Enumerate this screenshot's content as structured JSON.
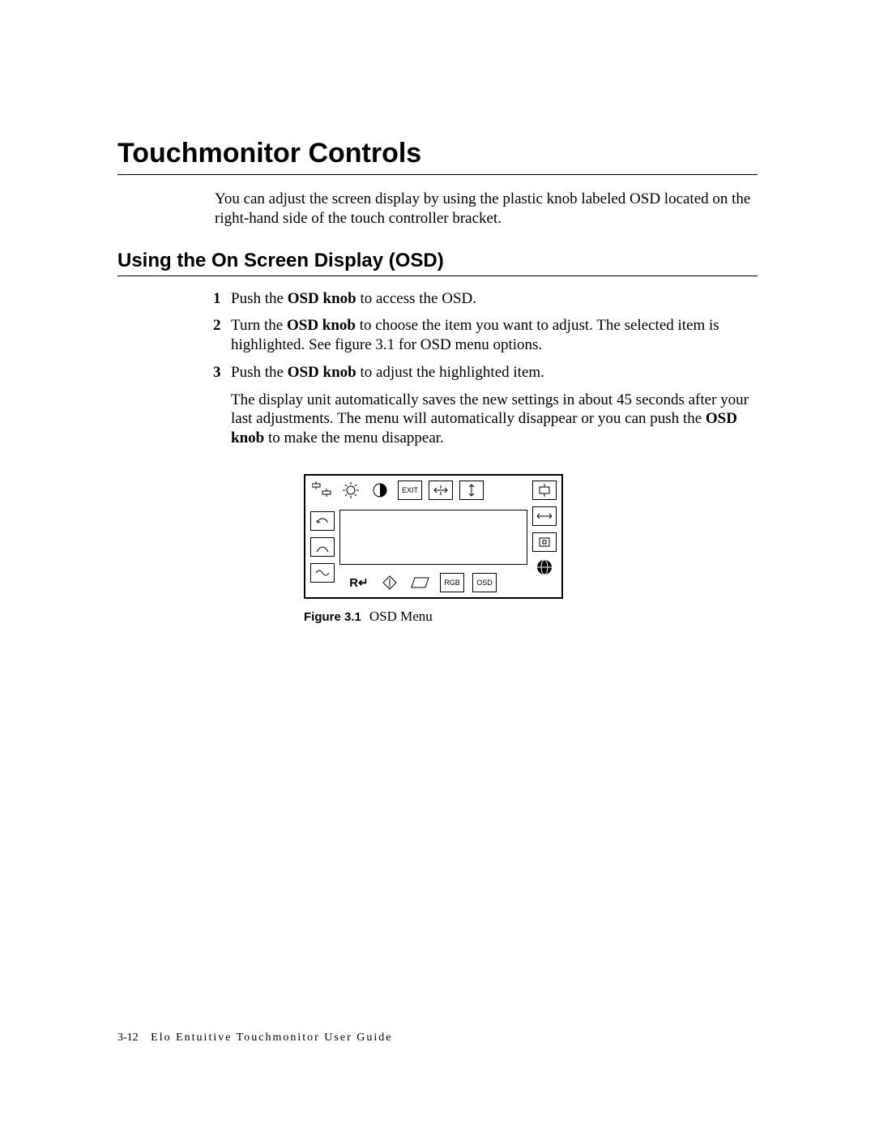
{
  "heading": "Touchmonitor Controls",
  "intro": "You can adjust the screen display by using the plastic knob labeled OSD located on the right-hand side of the touch controller bracket.",
  "subheading": "Using the On Screen Display (OSD)",
  "steps": [
    {
      "num": "1",
      "before": "Push the ",
      "bold": "OSD knob",
      "after": " to access the OSD."
    },
    {
      "num": "2",
      "before": "Turn the ",
      "bold": "OSD knob",
      "after": " to choose the item you want to adjust. The selected item is highlighted. See figure 3.1 for OSD menu options."
    },
    {
      "num": "3",
      "before": "Push the ",
      "bold": "OSD knob",
      "after": " to adjust the highlighted item."
    }
  ],
  "note_parts": {
    "a": "The display unit automatically saves the new settings in about 45 seconds after your last adjustments. The menu will automatically disappear or you can push the ",
    "b": "OSD knob",
    "c": " to make the menu disappear."
  },
  "osd": {
    "exit": "EXIT",
    "rgb": "RGB",
    "osd": "OSD",
    "recall": "R↵"
  },
  "figure": {
    "label": "Figure 3.1",
    "caption": "OSD Menu"
  },
  "footer": {
    "page": "3-12",
    "title": "Elo Entuitive Touchmonitor User Guide"
  }
}
